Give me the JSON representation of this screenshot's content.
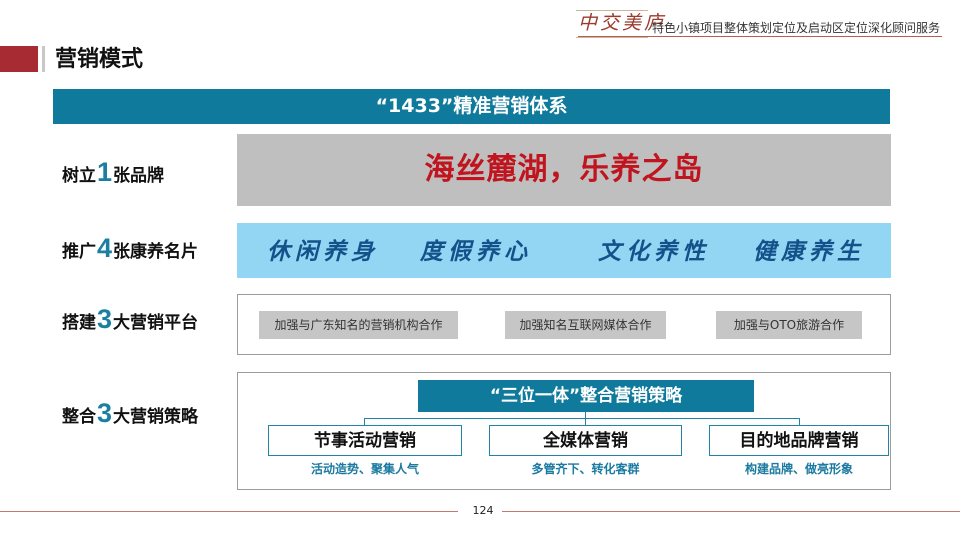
{
  "header": {
    "logo_text": "中交美庐",
    "title": "特色小镇项目整体策划定位及启动区定位深化顾问服务"
  },
  "page_title": "营销模式",
  "banner": "“1433”精准营销体系",
  "rows": [
    {
      "prefix": "树立",
      "number": "1",
      "suffix": "张品牌"
    },
    {
      "prefix": "推广",
      "number": "4",
      "suffix": "张康养名片"
    },
    {
      "prefix": "搭建",
      "number": "3",
      "suffix": "大营销平台"
    },
    {
      "prefix": "整合",
      "number": "3",
      "suffix": "大营销策略"
    }
  ],
  "brand_slogan": "海丝麓湖，乐养之岛",
  "cards": [
    "休闲养身",
    "度假养心",
    "文化养性",
    "健康养生"
  ],
  "platforms": [
    "加强与广东知名的营销机构合作",
    "加强知名互联网媒体合作",
    "加强与OTO旅游合作"
  ],
  "strategy": {
    "header": "“三位一体”整合营销策略",
    "items": [
      {
        "name": "节事活动营销",
        "desc": "活动造势、聚集人气"
      },
      {
        "name": "全媒体营销",
        "desc": "多管齐下、转化客群"
      },
      {
        "name": "目的地品牌营销",
        "desc": "构建品牌、做亮形象"
      }
    ]
  },
  "page_number": "124",
  "colors": {
    "accent_red": "#a72b33",
    "banner_blue": "#0f7a9b",
    "number_blue": "#1b7fa0",
    "slogan_red": "#c0141e",
    "card_bg": "#92d6f3",
    "card_text": "#12518a"
  }
}
